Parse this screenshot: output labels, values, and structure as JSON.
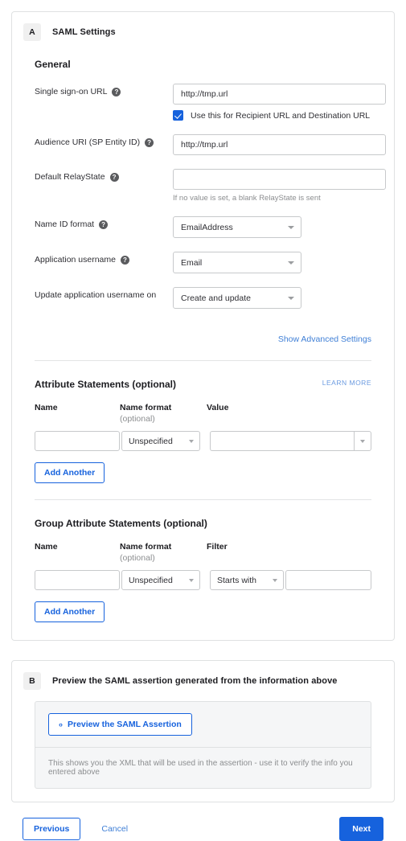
{
  "section_a": {
    "badge": "A",
    "title": "SAML Settings",
    "group_title": "General",
    "fields": {
      "sso_url": {
        "label": "Single sign-on URL",
        "help_icon": "help-icon",
        "value": "http://tmp.url",
        "checkbox_label": "Use this for Recipient URL and Destination URL",
        "checkbox_checked": true
      },
      "audience_uri": {
        "label": "Audience URI (SP Entity ID)",
        "help_icon": "help-icon",
        "value": "http://tmp.url"
      },
      "default_relaystate": {
        "label": "Default RelayState",
        "help_icon": "help-icon",
        "value": "",
        "hint": "If no value is set, a blank RelayState is sent"
      },
      "name_id_format": {
        "label": "Name ID format",
        "help_icon": "help-icon",
        "value": "EmailAddress"
      },
      "application_username": {
        "label": "Application username",
        "help_icon": "help-icon",
        "value": "Email"
      },
      "update_application_username_on": {
        "label": "Update application username on",
        "value": "Create and update"
      }
    },
    "show_advanced_link": "Show Advanced Settings",
    "attribute_statements": {
      "title": "Attribute Statements (optional)",
      "learn_more": "LEARN MORE",
      "columns": {
        "name": "Name",
        "name_format": "Name format",
        "name_format_optional": "(optional)",
        "value": "Value"
      },
      "row": {
        "name": "",
        "name_format": "Unspecified",
        "value": ""
      },
      "add_another": "Add Another"
    },
    "group_attribute_statements": {
      "title": "Group Attribute Statements (optional)",
      "columns": {
        "name": "Name",
        "name_format": "Name format",
        "name_format_optional": "(optional)",
        "filter": "Filter"
      },
      "row": {
        "name": "",
        "name_format": "Unspecified",
        "filter": "Starts with",
        "filter_value": ""
      },
      "add_another": "Add Another"
    }
  },
  "section_b": {
    "badge": "B",
    "title": "Preview the SAML assertion generated from the information above",
    "preview_button": "Preview the SAML Assertion",
    "preview_icon": "code-brackets-icon",
    "note": "This shows you the XML that will be used in the assertion - use it to verify the info you entered above"
  },
  "footer": {
    "previous": "Previous",
    "cancel": "Cancel",
    "next": "Next"
  },
  "colors": {
    "accent": "#1662dd",
    "link": "#3f7fd6",
    "learn_more": "#6a9ae0",
    "border": "#c7c9cb",
    "card_border": "#dfe1e2",
    "panel_bg": "#f5f6f7",
    "text": "#2f2f34"
  }
}
